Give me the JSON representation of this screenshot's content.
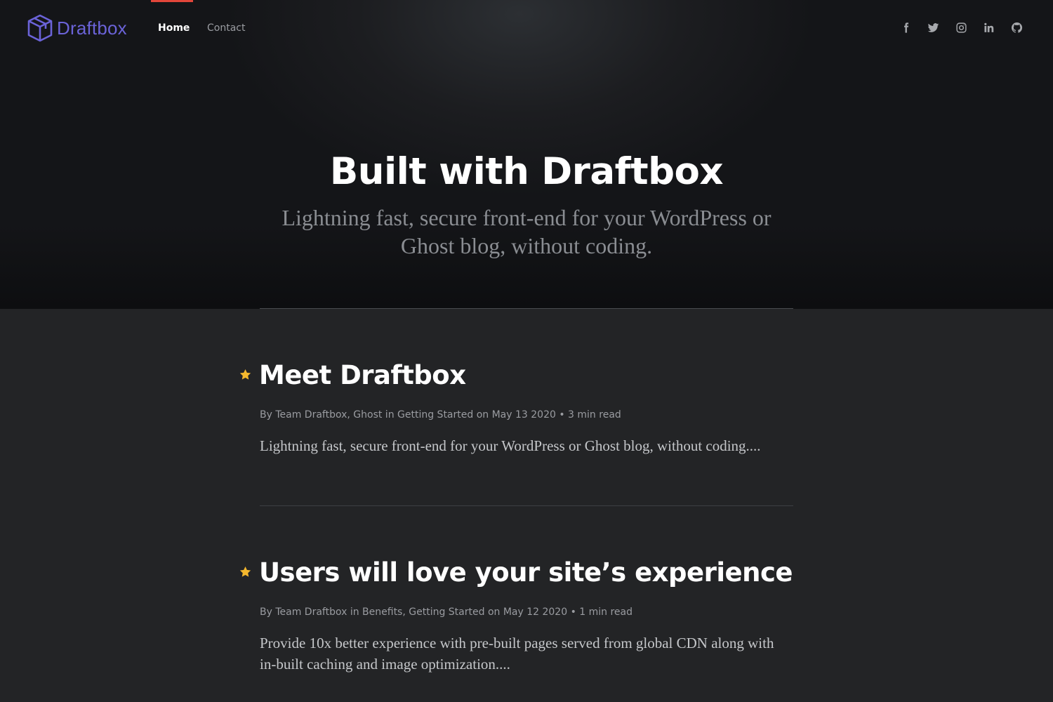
{
  "brand": {
    "name": "Draftbox",
    "color": "#6b63d8"
  },
  "nav": {
    "items": [
      {
        "label": "Home",
        "active": true
      },
      {
        "label": "Contact",
        "active": false
      }
    ],
    "active_indicator_color": "#e2463a"
  },
  "social": {
    "icons": [
      "facebook-icon",
      "twitter-icon",
      "instagram-icon",
      "linkedin-icon",
      "github-icon"
    ]
  },
  "hero": {
    "title": "Built with Draftbox",
    "subtitle": "Lightning fast, secure front-end for your WordPress or Ghost blog, without coding."
  },
  "posts": [
    {
      "featured": true,
      "title": "Meet Draftbox",
      "meta": "By Team Draftbox, Ghost in Getting Started on May 13 2020 • 3 min read",
      "excerpt": "Lightning fast, secure front-end for your WordPress or Ghost blog, without coding...."
    },
    {
      "featured": true,
      "title": "Users will love your site’s experience",
      "meta": "By Team Draftbox in Benefits, Getting Started on May 12 2020 • 1 min read",
      "excerpt": "Provide 10x better experience with pre-built pages served from global CDN along with in-built caching and image optimization...."
    }
  ],
  "colors": {
    "star": "#f5b82e",
    "background": "#232426"
  }
}
